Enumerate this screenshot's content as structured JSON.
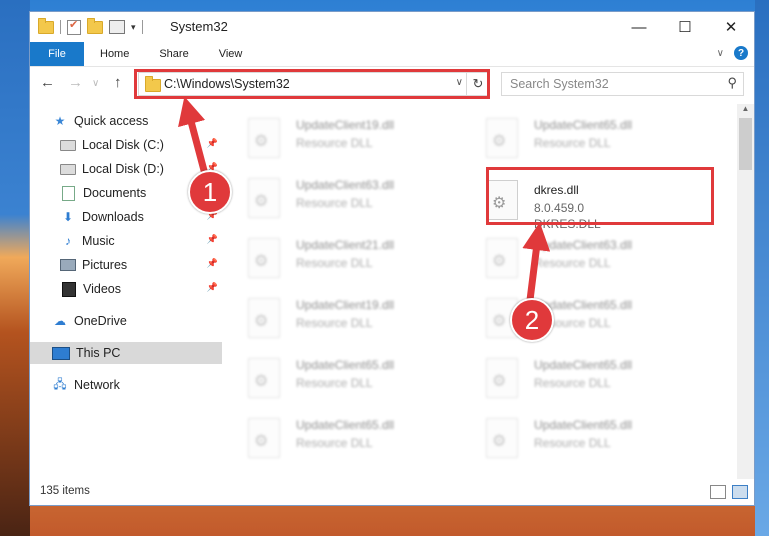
{
  "window": {
    "title": "System32",
    "controls": {
      "minimize": "—",
      "maximize": "☐",
      "close": "✕"
    }
  },
  "ribbon": {
    "file_tab": "File",
    "tabs": [
      "Home",
      "Share",
      "View"
    ]
  },
  "navigation": {
    "address": "C:\\Windows\\System32",
    "search_placeholder": "Search System32"
  },
  "sidebar": {
    "items": [
      {
        "label": "Quick access",
        "icon": "star-icon"
      },
      {
        "label": "Local Disk (C:)",
        "icon": "drive-icon",
        "pinned": true
      },
      {
        "label": "Local Disk (D:)",
        "icon": "drive-icon",
        "pinned": true
      },
      {
        "label": "Documents",
        "icon": "documents-icon",
        "pinned": true
      },
      {
        "label": "Downloads",
        "icon": "download-icon",
        "pinned": true
      },
      {
        "label": "Music",
        "icon": "music-icon",
        "pinned": true
      },
      {
        "label": "Pictures",
        "icon": "pictures-icon",
        "pinned": true
      },
      {
        "label": "Videos",
        "icon": "videos-icon",
        "pinned": true
      },
      {
        "label": "OneDrive",
        "icon": "cloud-icon"
      },
      {
        "label": "This PC",
        "icon": "computer-icon",
        "selected": true
      },
      {
        "label": "Network",
        "icon": "network-icon"
      }
    ]
  },
  "files": {
    "col1": [
      {
        "name": "UpdateClient19.dll",
        "desc": "Resource DLL"
      },
      {
        "name": "UpdateClient63.dll",
        "desc": "Resource DLL"
      },
      {
        "name": "UpdateClient21.dll",
        "desc": "Resource DLL"
      },
      {
        "name": "UpdateClient19.dll",
        "desc": "Resource DLL"
      },
      {
        "name": "UpdateClient65.dll",
        "desc": "Resource DLL"
      },
      {
        "name": "UpdateClient65.dll",
        "desc": "Resource DLL"
      }
    ],
    "col2": [
      {
        "name": "UpdateClient65.dll",
        "desc": "Resource DLL"
      },
      {
        "name": "dkres.dll",
        "version": "8.0.459.0",
        "desc": "DKRES.DLL",
        "highlighted": true
      },
      {
        "name": "UpdateClient63.dll",
        "desc": "Resource DLL"
      },
      {
        "name": "UpdateClient65.dll",
        "desc": "Resource DLL"
      },
      {
        "name": "UpdateClient65.dll",
        "desc": "Resource DLL"
      },
      {
        "name": "UpdateClient65.dll",
        "desc": "Resource DLL"
      }
    ]
  },
  "status": {
    "item_count": "135 items"
  },
  "annotations": {
    "step1": "1",
    "step2": "2",
    "color": "#e0393b"
  }
}
